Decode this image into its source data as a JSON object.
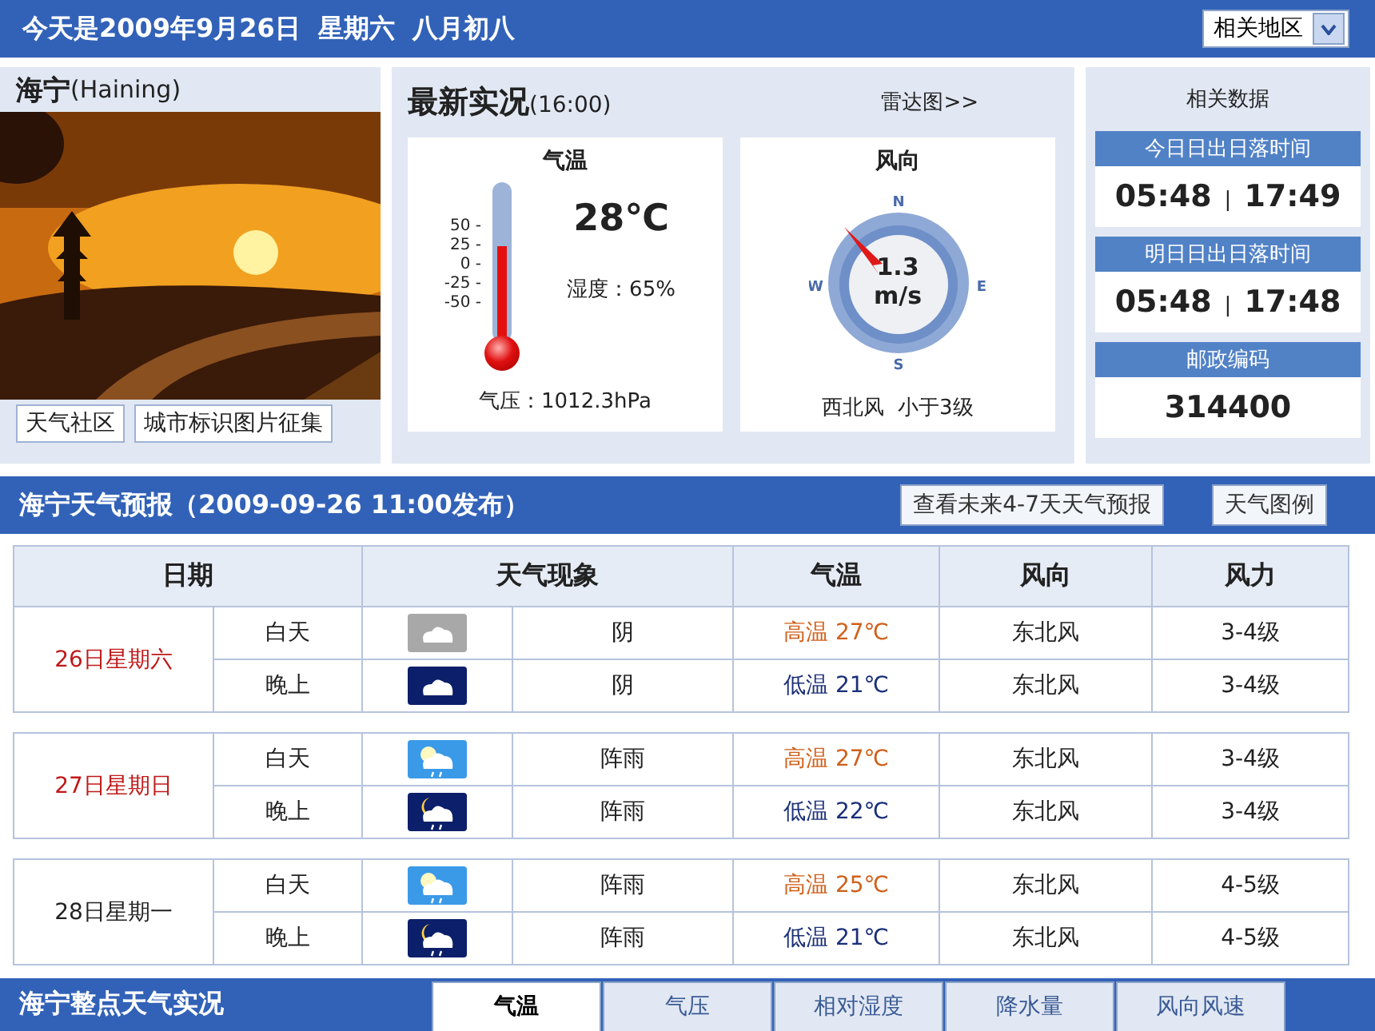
{
  "header": {
    "date_line": "今天是2009年9月26日  星期六  八月初八",
    "region_select": "相关地区"
  },
  "city": {
    "name": "海宁",
    "name_en": "(Haining)",
    "links": [
      "天气社区",
      "城市标识图片征集"
    ]
  },
  "current": {
    "title": "最新实况",
    "time": "(16:00)",
    "radar_link": "雷达图>>",
    "temperature": {
      "title": "气温",
      "value": "28℃",
      "humidity": "湿度：65%",
      "pressure": "气压：1012.3hPa",
      "scale": [
        "50 -",
        "25 -",
        "0 -",
        "-25 -",
        "-50 -"
      ],
      "level": 0.6
    },
    "wind": {
      "title": "风向",
      "speed": "1.3",
      "unit": "m/s",
      "compass": [
        "N",
        "E",
        "S",
        "W"
      ],
      "description": "西北风  小于3级"
    }
  },
  "related": {
    "title": "相关数据",
    "blocks": [
      {
        "label": "今日日出日落时间",
        "sunrise": "05:48",
        "separator": "|",
        "sunset": "17:49"
      },
      {
        "label": "明日日出日落时间",
        "sunrise": "05:48",
        "separator": "|",
        "sunset": "17:48"
      },
      {
        "label": "邮政编码",
        "value": "314400"
      }
    ]
  },
  "forecast": {
    "title": "海宁天气预报（2009-09-26 11:00发布）",
    "buttons": [
      "查看未来4-7天天气预报",
      "天气图例"
    ],
    "columns": [
      "日期",
      "天气现象",
      "气温",
      "风向",
      "风力"
    ],
    "days": [
      {
        "date": "26日星期六",
        "weekend": true,
        "periods": [
          {
            "label": "白天",
            "night": false,
            "kind": "overcast",
            "weather": "阴",
            "temp": "高温 27℃",
            "wind_dir": "东北风",
            "wind_force": "3-4级"
          },
          {
            "label": "晚上",
            "night": true,
            "kind": "overcast",
            "weather": "阴",
            "temp": "低温 21℃",
            "wind_dir": "东北风",
            "wind_force": "3-4级"
          }
        ]
      },
      {
        "date": "27日星期日",
        "weekend": true,
        "periods": [
          {
            "label": "白天",
            "night": false,
            "kind": "shower",
            "weather": "阵雨",
            "temp": "高温 27℃",
            "wind_dir": "东北风",
            "wind_force": "3-4级"
          },
          {
            "label": "晚上",
            "night": true,
            "kind": "shower",
            "weather": "阵雨",
            "temp": "低温 22℃",
            "wind_dir": "东北风",
            "wind_force": "3-4级"
          }
        ]
      },
      {
        "date": "28日星期一",
        "weekend": false,
        "periods": [
          {
            "label": "白天",
            "night": false,
            "kind": "shower",
            "weather": "阵雨",
            "temp": "高温 25℃",
            "wind_dir": "东北风",
            "wind_force": "4-5级"
          },
          {
            "label": "晚上",
            "night": true,
            "kind": "shower",
            "weather": "阵雨",
            "temp": "低温 21℃",
            "wind_dir": "东北风",
            "wind_force": "4-5级"
          }
        ]
      }
    ]
  },
  "hourly": {
    "title": "海宁整点天气实况",
    "tabs": [
      {
        "label": "气温",
        "selected": true
      },
      {
        "label": "气压",
        "selected": false
      },
      {
        "label": "相对湿度",
        "selected": false
      },
      {
        "label": "降水量",
        "selected": false
      },
      {
        "label": "风向风速",
        "selected": false
      }
    ]
  }
}
